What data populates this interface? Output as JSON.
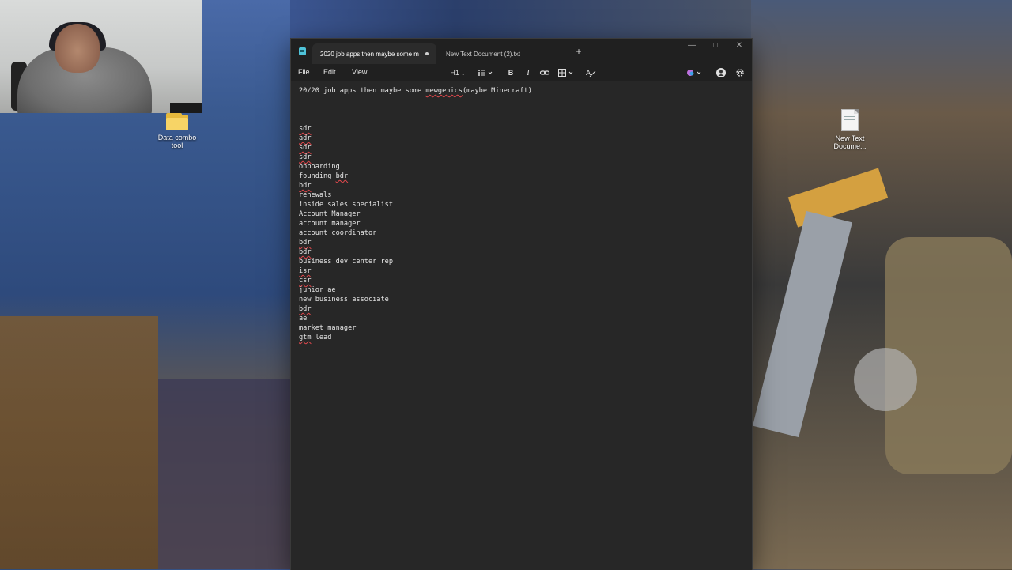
{
  "desktop": {
    "icons": [
      {
        "label_line1": "Data combo",
        "label_line2": "tool",
        "icon": "folder-icon"
      },
      {
        "label_line1": "New Text",
        "label_line2": "Docume...",
        "icon": "text-file-icon"
      }
    ]
  },
  "notepad": {
    "tabs": [
      {
        "title": "2020 job apps then maybe some m",
        "active": true,
        "unsaved": true
      },
      {
        "title": "New Text Document (2).txt",
        "active": false
      }
    ],
    "menu": [
      "File",
      "Edit",
      "View"
    ],
    "toolbar": {
      "heading_label": "H1",
      "icons": [
        "heading-dropdown",
        "list-icon",
        "bold-icon",
        "italic-icon",
        "link-icon",
        "table-icon",
        "clear-format-icon",
        "copilot-icon",
        "account-icon",
        "settings-icon"
      ]
    },
    "document": {
      "title_line": "20/20 job apps then maybe some mewgenics(maybe Minecraft)",
      "lines": [
        "sdr",
        "adr",
        "sdr",
        "sdr",
        "onboarding",
        "founding bdr",
        "bdr",
        "renewals",
        "inside sales specialist",
        "Account Manager",
        "account manager",
        "account coordinator",
        "bdr",
        "bdr",
        "business dev center rep",
        "isr",
        "csr",
        "junior ae",
        "new business associate",
        "bdr",
        "ae",
        "market manager",
        "gtm lead"
      ]
    }
  },
  "colors": {
    "window_bg": "#202020",
    "editor_bg": "#272727",
    "spellcheck": "#e5484d",
    "folder": "#f7d466"
  }
}
